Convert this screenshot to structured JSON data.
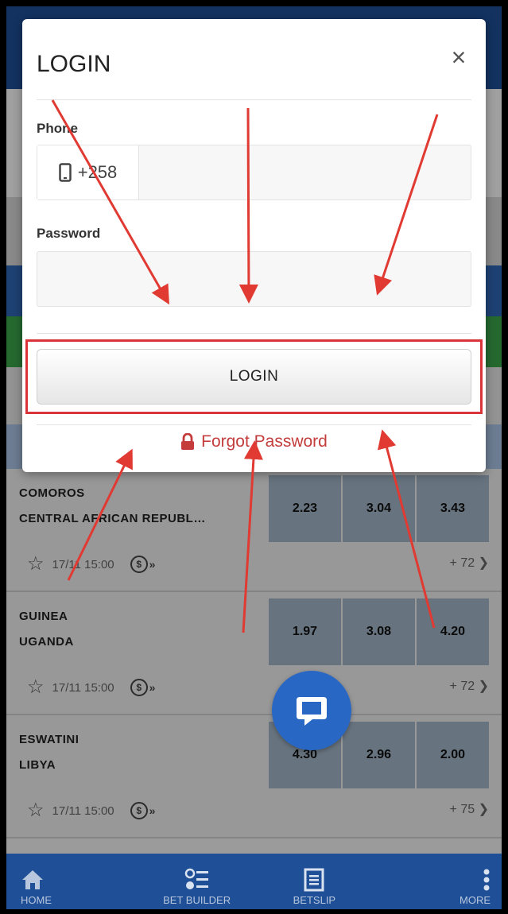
{
  "modal": {
    "title": "LOGIN",
    "close_symbol": "×",
    "phone_label": "Phone",
    "phone_prefix": "+258",
    "phone_value": "",
    "password_label": "Password",
    "password_value": "",
    "login_button": "LOGIN",
    "forgot_password": "Forgot Password"
  },
  "matches": [
    {
      "team1": "COMOROS",
      "team2": "CENTRAL AFRICAN REPUBL…",
      "odds": [
        "2.23",
        "3.04",
        "3.43"
      ],
      "datetime": "17/11 15:00",
      "more_markets": "+ 72"
    },
    {
      "team1": "GUINEA",
      "team2": "UGANDA",
      "odds": [
        "1.97",
        "3.08",
        "4.20"
      ],
      "datetime": "17/11 15:00",
      "more_markets": "+ 72"
    },
    {
      "team1": "ESWATINI",
      "team2": "LIBYA",
      "odds": [
        "4.30",
        "2.96",
        "2.00"
      ],
      "datetime": "17/11 15:00",
      "more_markets": "+ 75"
    }
  ],
  "bottom_nav": [
    {
      "label": "HOME",
      "icon": "home-icon"
    },
    {
      "label": "BET BUILDER",
      "icon": "bet-builder-icon"
    },
    {
      "label": "BETSLIP",
      "icon": "betslip-icon"
    },
    {
      "label": "MORE",
      "icon": "more-vertical-icon"
    }
  ],
  "colors": {
    "header_blue": "#1f4f96",
    "odds_bg": "#a1b4c6",
    "annotation_red": "#d9343a",
    "chat_fab": "#2868c4"
  }
}
